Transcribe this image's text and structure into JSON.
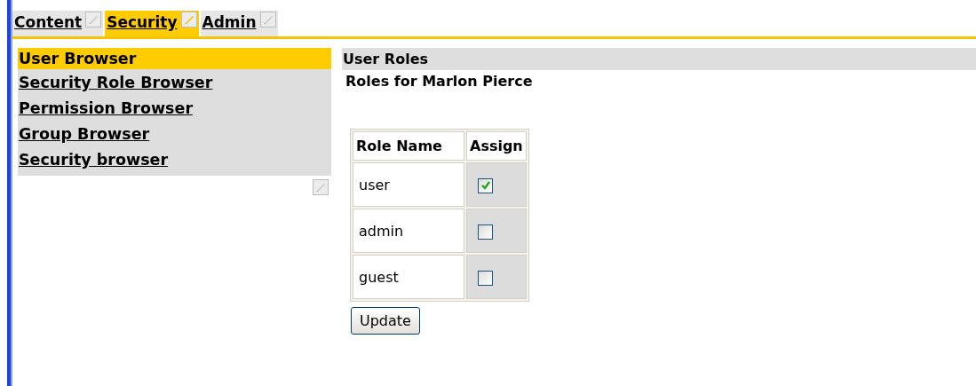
{
  "tabs": [
    {
      "label": "Content",
      "selected": false
    },
    {
      "label": "Security",
      "selected": true
    },
    {
      "label": "Admin",
      "selected": false
    }
  ],
  "sidebar": {
    "items": [
      {
        "label": "User Browser",
        "selected": true
      },
      {
        "label": "Security Role Browser",
        "selected": false
      },
      {
        "label": "Permission Browser",
        "selected": false
      },
      {
        "label": "Group Browser",
        "selected": false
      },
      {
        "label": "Security browser",
        "selected": false
      }
    ]
  },
  "panel": {
    "title": "User Roles",
    "subtitle": "Roles for Marlon Pierce",
    "table": {
      "columns": [
        "Role Name",
        "Assign"
      ],
      "rows": [
        {
          "name": "user",
          "checked": true
        },
        {
          "name": "admin",
          "checked": false
        },
        {
          "name": "guest",
          "checked": false
        }
      ]
    },
    "button": "Update"
  }
}
